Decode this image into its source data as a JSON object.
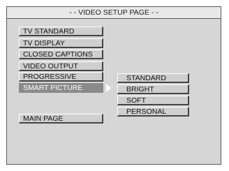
{
  "title": "- - VIDEO SETUP PAGE - -",
  "menu": {
    "items": [
      {
        "label": "TV STANDARD"
      },
      {
        "label": "TV DISPLAY"
      },
      {
        "label": "CLOSED CAPTIONS"
      },
      {
        "label": "VIDEO OUTPUT"
      },
      {
        "label": "PROGRESSIVE"
      },
      {
        "label": "SMART PICTURE"
      }
    ],
    "selected": "SMART PICTURE",
    "main_page": "MAIN PAGE"
  },
  "submenu": {
    "items": [
      {
        "label": "STANDARD"
      },
      {
        "label": "BRIGHT"
      },
      {
        "label": "SOFT"
      },
      {
        "label": "PERSONAL"
      }
    ]
  },
  "colors": {
    "background": "#d6d6d6",
    "selected": "#8a8a8a",
    "item": "#cfcfcf"
  },
  "icons": {
    "selection_arrow": "arrow-right-icon"
  }
}
